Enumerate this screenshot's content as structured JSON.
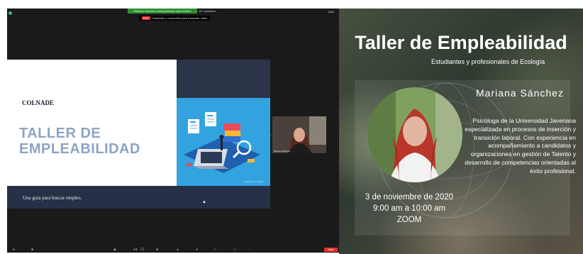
{
  "zoom": {
    "recording_label": "Mariana Sánchez está grabando esta reunión",
    "speaker_view_label": "Ver Speakers",
    "view_label": "Vista",
    "notice_tag": "REC",
    "notice_text": "Grabando y encendido para transmitir video",
    "participant_name": "Mariana Sánchez",
    "participants_count": "21",
    "end_label": "Salir"
  },
  "slide": {
    "brand": "COLNADE",
    "title_line1": "TALLER DE",
    "title_line2": "EMPLEABILIDAD",
    "subtitle": "Una guía para buscar empleo.",
    "image_credit": "Designed by Freepik"
  },
  "poster": {
    "title": "Taller de Empleabilidad",
    "subtitle": "Estudiantes y profesionales de Ecología",
    "speaker_name": "Mariana Sánchez",
    "bio": "Psicóloga de la Universidad Javeriana especializada en procesos de inserción y transición laboral. Con experiencia en acompañamiento a candidatos y organizaciones en gestión de Talento y desarrollo de competencias orientadas al éxito profesional.",
    "date": "3 de noviembre de 2020",
    "time": "9:00 am a 10:00 am",
    "platform": "ZOOM"
  },
  "colors": {
    "zoom_bg": "#1a1a1a",
    "slide_title": "#8ea3c4",
    "slide_navy": "#263046",
    "slide_blue": "#33a3df",
    "end_red": "#e5302f"
  }
}
